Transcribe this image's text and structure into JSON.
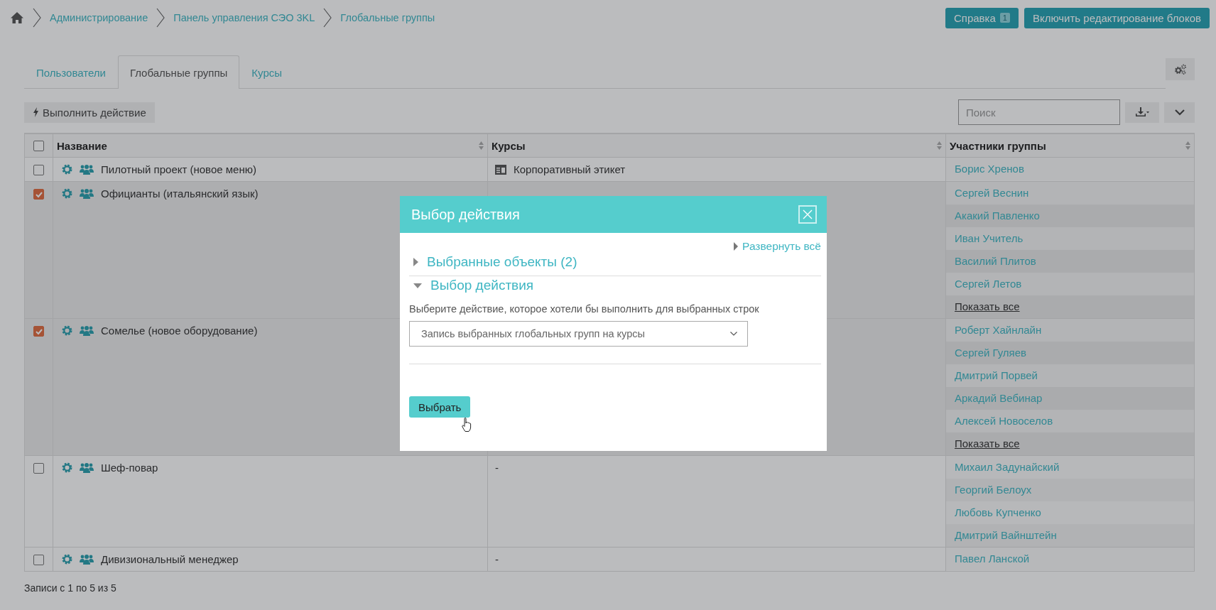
{
  "breadcrumb": [
    "Администрирование",
    "Панель управления СЭО 3KL",
    "Глобальные группы"
  ],
  "header_buttons": [
    {
      "label": "Справка",
      "badge": "1"
    },
    {
      "label": "Включить редактирование блоков"
    }
  ],
  "tabs": [
    {
      "label": "Пользователи",
      "selected": false
    },
    {
      "label": "Глобальные группы",
      "selected": true
    },
    {
      "label": "Курсы",
      "selected": false
    }
  ],
  "action_button": "Выполнить действие",
  "search": {
    "placeholder": "Поиск"
  },
  "table": {
    "header_checked": false,
    "columns": [
      "Название",
      "Курсы",
      "Участники группы"
    ],
    "rows": [
      {
        "checked": false,
        "name": "Пилотный проект (новое меню)",
        "courses": [
          {
            "kind": "course",
            "label": "Корпоративный этикет"
          }
        ],
        "members": [
          "Борис Хренов"
        ]
      },
      {
        "checked": true,
        "name": "Официанты (итальянский язык)",
        "members": [
          "Сергей Веснин",
          "Акакий Павленко",
          "Иван Учитель",
          "Василий Плитов",
          "Сергей Летов"
        ],
        "show_all": "Показать все"
      },
      {
        "checked": true,
        "name": "Сомелье (новое оборудование)",
        "members": [
          "Роберт Хайнлайн",
          "Сергей Гуляев",
          "Дмитрий Порвей",
          "Аркадий Вебинар",
          "Алексей Новоселов"
        ],
        "show_all": "Показать все"
      },
      {
        "checked": false,
        "name": "Шеф-повар",
        "courses": [
          {
            "kind": "dash",
            "label": "-"
          }
        ],
        "members": [
          "Михаил Задунайский",
          "Георгий Белоух",
          "Любовь Купченко",
          "Дмитрий Вайнштейн"
        ]
      },
      {
        "checked": false,
        "name": "Дивизиональный менеджер",
        "courses": [
          {
            "kind": "dash",
            "label": "-"
          }
        ],
        "members": [
          "Павел Ланской"
        ]
      }
    ]
  },
  "footer": "Записи с 1 по 5 из 5",
  "modal": {
    "title": "Выбор действия",
    "expand_all": "Развернуть всё",
    "sections": [
      {
        "title": "Выбранные объекты (2)",
        "expanded": false
      },
      {
        "title": "Выбор действия",
        "expanded": true,
        "description": "Выберите действие, которое хотели бы выполнить для выбранных строк",
        "select_value": "Запись выбранных глобальных групп на курсы"
      }
    ],
    "submit": "Выбрать"
  }
}
